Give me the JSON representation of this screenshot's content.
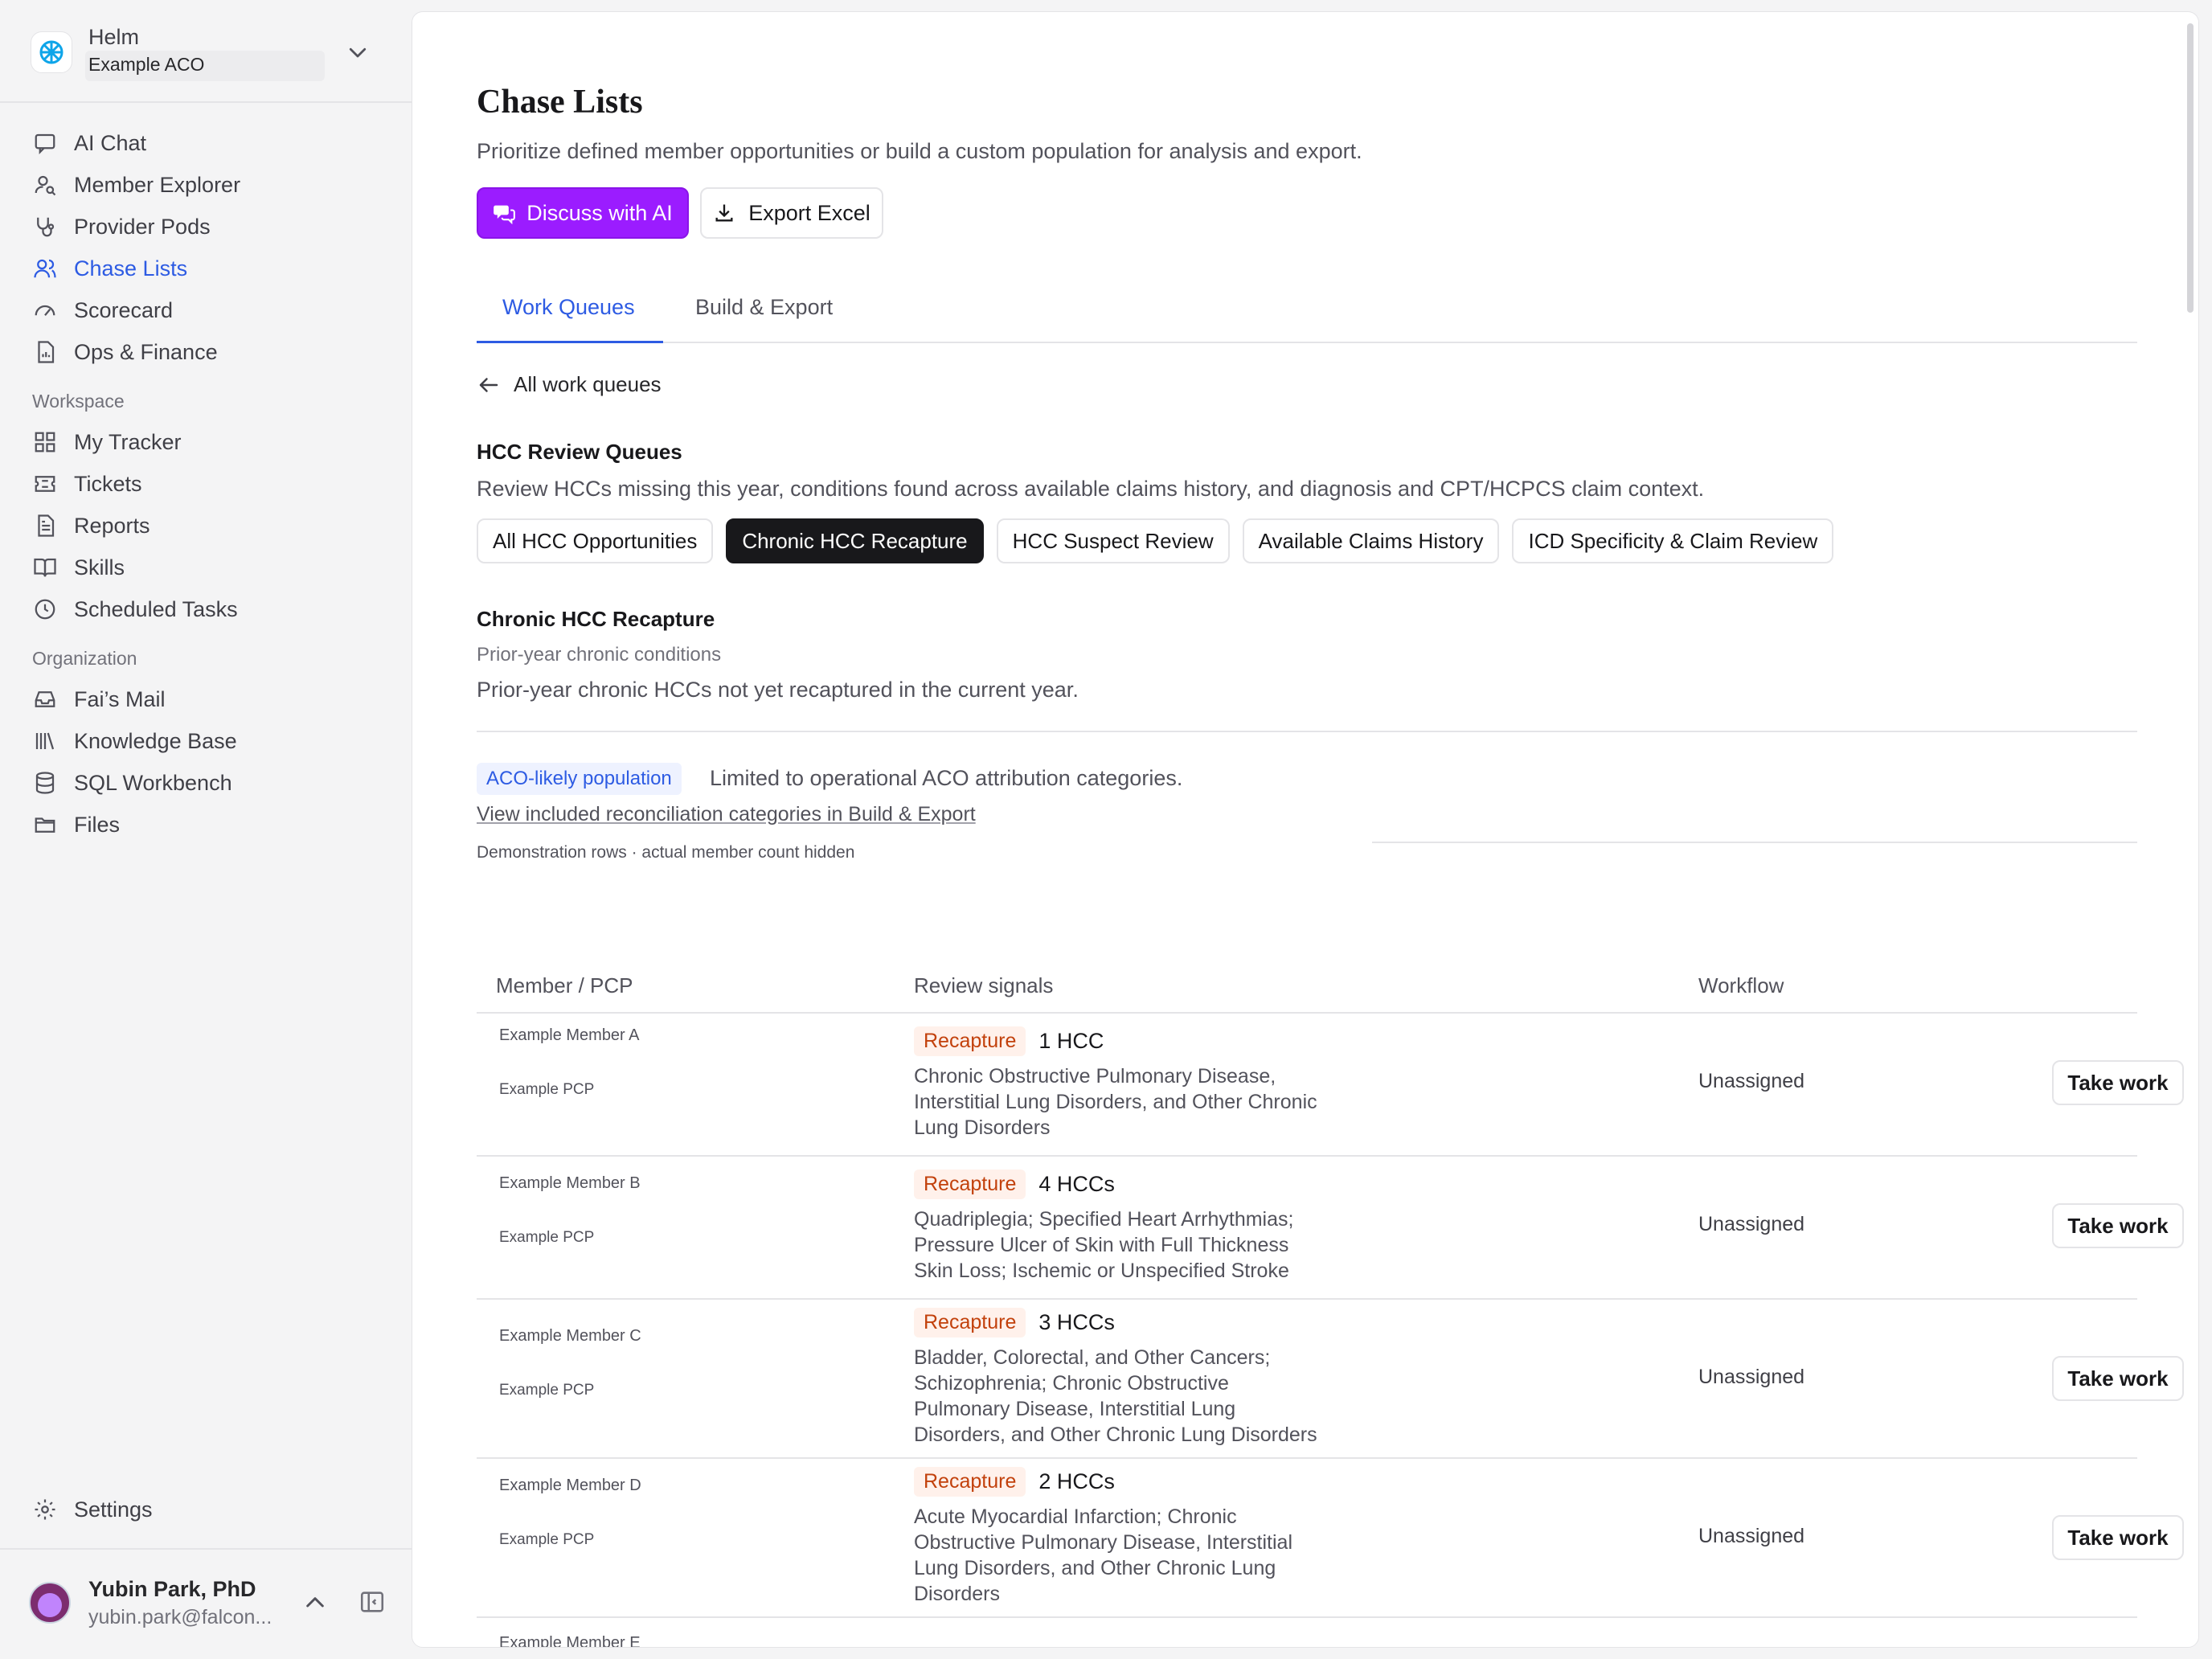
{
  "org": {
    "name": "Helm",
    "subtitle": "Example ACO"
  },
  "nav": {
    "primary": [
      {
        "label": "AI Chat",
        "icon": "chat-icon"
      },
      {
        "label": "Member Explorer",
        "icon": "user-search-icon"
      },
      {
        "label": "Provider Pods",
        "icon": "stethoscope-icon"
      },
      {
        "label": "Chase Lists",
        "icon": "users-icon",
        "active": true
      },
      {
        "label": "Scorecard",
        "icon": "gauge-icon"
      },
      {
        "label": "Ops & Finance",
        "icon": "report-file-icon"
      }
    ],
    "workspace_label": "Workspace",
    "workspace": [
      {
        "label": "My Tracker",
        "icon": "grid-icon"
      },
      {
        "label": "Tickets",
        "icon": "ticket-icon"
      },
      {
        "label": "Reports",
        "icon": "document-icon"
      },
      {
        "label": "Skills",
        "icon": "book-icon"
      },
      {
        "label": "Scheduled Tasks",
        "icon": "clock-icon"
      }
    ],
    "organization_label": "Organization",
    "organization": [
      {
        "label": "Fai’s Mail",
        "icon": "inbox-icon"
      },
      {
        "label": "Knowledge Base",
        "icon": "library-icon"
      },
      {
        "label": "SQL Workbench",
        "icon": "database-icon"
      },
      {
        "label": "Files",
        "icon": "folder-icon"
      }
    ],
    "settings": "Settings"
  },
  "user": {
    "name": "Yubin Park, PhD",
    "email": "yubin.park@falcon..."
  },
  "page": {
    "title": "Chase Lists",
    "subtitle": "Prioritize defined member opportunities or build a custom population for analysis and export.",
    "discuss_label": "Discuss with AI",
    "export_label": "Export Excel",
    "tabs": [
      "Work Queues",
      "Build & Export"
    ],
    "back_label": "All work queues"
  },
  "queues": {
    "title": "HCC Review Queues",
    "description": "Review HCCs missing this year, conditions found across available claims history, and diagnosis and CPT/HCPCS claim context.",
    "chips": [
      "All HCC Opportunities",
      "Chronic HCC Recapture",
      "HCC Suspect Review",
      "Available Claims History",
      "ICD Specificity & Claim Review"
    ],
    "active_chip": "Chronic HCC Recapture"
  },
  "selected": {
    "title": "Chronic HCC Recapture",
    "subtitle": "Prior-year chronic conditions",
    "description": "Prior-year chronic HCCs not yet recaptured in the current year.",
    "population_badge": "ACO-likely population",
    "population_note": "Limited to operational ACO attribution categories.",
    "population_link": "View included reconciliation categories in Build & Export",
    "demo_note": "Demonstration rows · actual member count hidden"
  },
  "table": {
    "headers": {
      "member": "Member / PCP",
      "signals": "Review signals",
      "workflow": "Workflow"
    },
    "rows": [
      {
        "member": "Example Member A",
        "pcp": "Example PCP",
        "tag": "Recapture",
        "count": "1 HCC",
        "desc_lines": [
          "Chronic Obstructive Pulmonary Disease,",
          "Interstitial Lung Disorders, and Other Chronic",
          "Lung Disorders"
        ],
        "workflow": "Unassigned",
        "action": "Take work"
      },
      {
        "member": "Example Member B",
        "pcp": "Example PCP",
        "tag": "Recapture",
        "count": "4 HCCs",
        "desc_lines": [
          "Quadriplegia; Specified Heart Arrhythmias;",
          "Pressure Ulcer of Skin with Full Thickness",
          "Skin Loss; Ischemic or Unspecified Stroke"
        ],
        "workflow": "Unassigned",
        "action": "Take work"
      },
      {
        "member": "Example Member C",
        "pcp": "Example PCP",
        "tag": "Recapture",
        "count": "3 HCCs",
        "desc_lines": [
          "Bladder, Colorectal, and Other Cancers;",
          "Schizophrenia; Chronic Obstructive",
          "Pulmonary Disease, Interstitial Lung",
          "Disorders, and Other Chronic Lung Disorders"
        ],
        "workflow": "Unassigned",
        "action": "Take work"
      },
      {
        "member": "Example Member D",
        "pcp": "Example PCP",
        "tag": "Recapture",
        "count": "2 HCCs",
        "desc_lines": [
          "Acute Myocardial Infarction; Chronic",
          "Obstructive Pulmonary Disease, Interstitial",
          "Lung Disorders, and Other Chronic Lung",
          "Disorders"
        ],
        "workflow": "Unassigned",
        "action": "Take work"
      }
    ],
    "partial_row_member": "Example Member E"
  }
}
